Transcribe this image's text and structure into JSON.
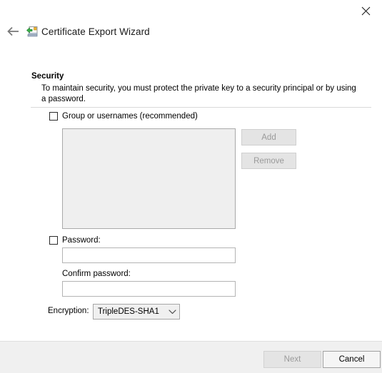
{
  "window": {
    "title": "Certificate Export Wizard",
    "title_icon": "certificate-export-icon",
    "close_icon": "close-icon",
    "back_icon": "back-arrow-icon"
  },
  "page": {
    "heading": "Security",
    "description": "To maintain security, you must protect the private key to a security principal or by using a password."
  },
  "form": {
    "group_checkbox_label": "Group or usernames (recommended)",
    "group_checkbox_checked": false,
    "listbox_items": [],
    "add_label": "Add",
    "add_enabled": false,
    "remove_label": "Remove",
    "remove_enabled": false,
    "password_checkbox_label": "Password:",
    "password_checkbox_checked": false,
    "password_value": "",
    "confirm_password_label": "Confirm password:",
    "confirm_password_value": "",
    "encryption_label": "Encryption:",
    "encryption_value": "TripleDES-SHA1",
    "encryption_chevron_icon": "chevron-down-icon"
  },
  "footer": {
    "next_label": "Next",
    "next_enabled": false,
    "cancel_label": "Cancel",
    "cancel_enabled": true
  },
  "colors": {
    "background": "#ffffff",
    "footer_background": "#f0f0f0",
    "disabled_text": "#9a9a9a",
    "listbox_background": "#efefef",
    "border": "#a9a9a9"
  }
}
